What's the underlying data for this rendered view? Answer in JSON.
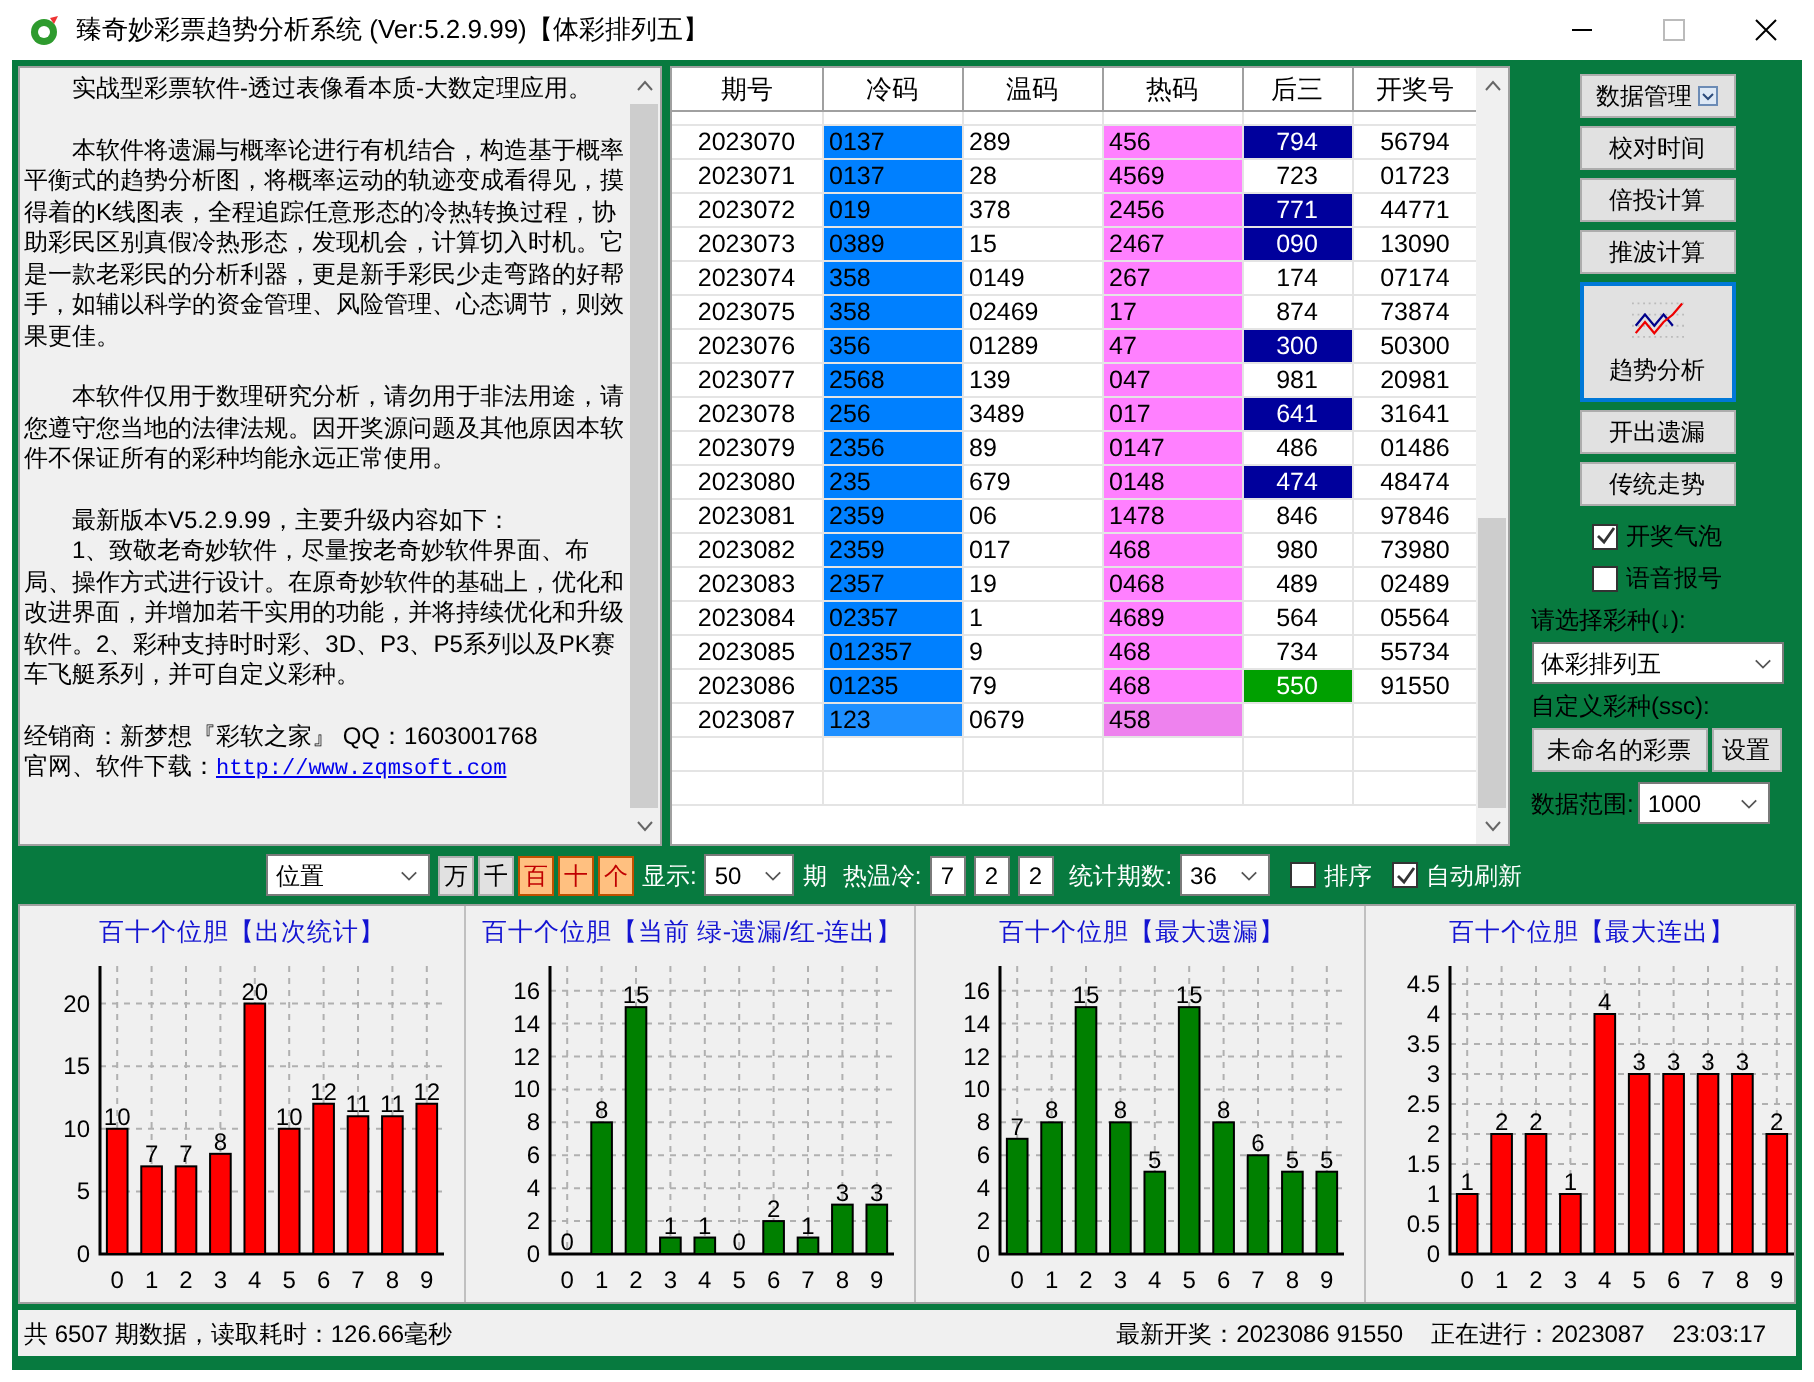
{
  "window": {
    "title": "臻奇妙彩票趋势分析系统 (Ver:5.2.9.99)【体彩排列五】"
  },
  "intro": [
    {
      "kind": "para",
      "text": "实战型彩票软件-透过表像看本质-大数定理应用。"
    },
    {
      "kind": "para",
      "text": "本软件将遗漏与概率论进行有机结合，构造基于概率平衡式的趋势分析图，将概率运动的轨迹变成看得见，摸得着的K线图表，全程追踪任意形态的冷热转换过程，协助彩民区别真假冷热形态，发现机会，计算切入时机。它是一款老彩民的分析利器，更是新手彩民少走弯路的好帮手，如辅以科学的资金管理、风险管理、心态调节，则效果更佳。"
    },
    {
      "kind": "para",
      "text": "本软件仅用于数理研究分析，请勿用于非法用途，请您遵守您当地的法律法规。因开奖源问题及其他原因本软件不保证所有的彩种均能永远正常使用。"
    },
    {
      "kind": "para",
      "text": "最新版本V5.2.9.99，主要升级内容如下："
    },
    {
      "kind": "item",
      "text": "1、致敬老奇妙软件，尽量按老奇妙软件界面、布局、操作方式进行设计。在原奇妙软件的基础上，优化和改进界面，并增加若干实用的功能，并将持续优化和升级软件。2、彩种支持时时彩、3D、P3、P5系列以及PK赛车飞艇系列，并可自定义彩种。"
    },
    {
      "kind": "line",
      "text": "经销商：新梦想『彩软之家』 QQ：1603001768"
    },
    {
      "kind": "link",
      "text": "官网、软件下载：",
      "link": "http://www.zqmsoft.com"
    }
  ],
  "table": {
    "columns": [
      "期号",
      "冷码",
      "温码",
      "热码",
      "后三",
      "开奖号"
    ],
    "rows": [
      {
        "period": "2023070",
        "cold": "0137",
        "warm": "289",
        "hot": "456",
        "last3": "794",
        "number": "56794",
        "color": "#00009c",
        "pending": false
      },
      {
        "period": "2023071",
        "cold": "0137",
        "warm": "28",
        "hot": "4569",
        "last3": "723",
        "number": "01723",
        "pending": false
      },
      {
        "period": "2023072",
        "cold": "019",
        "warm": "378",
        "hot": "2456",
        "last3": "771",
        "number": "44771",
        "color": "#00009c",
        "pending": false
      },
      {
        "period": "2023073",
        "cold": "0389",
        "warm": "15",
        "hot": "2467",
        "last3": "090",
        "number": "13090",
        "color": "#00009c",
        "pending": false
      },
      {
        "period": "2023074",
        "cold": "358",
        "warm": "0149",
        "hot": "267",
        "last3": "174",
        "number": "07174",
        "pending": false
      },
      {
        "period": "2023075",
        "cold": "358",
        "warm": "02469",
        "hot": "17",
        "last3": "874",
        "number": "73874",
        "pending": false
      },
      {
        "period": "2023076",
        "cold": "356",
        "warm": "01289",
        "hot": "47",
        "last3": "300",
        "number": "50300",
        "color": "#00009c",
        "pending": false
      },
      {
        "period": "2023077",
        "cold": "2568",
        "warm": "139",
        "hot": "047",
        "last3": "981",
        "number": "20981",
        "pending": false
      },
      {
        "period": "2023078",
        "cold": "256",
        "warm": "3489",
        "hot": "017",
        "last3": "641",
        "number": "31641",
        "color": "#00009c",
        "pending": false
      },
      {
        "period": "2023079",
        "cold": "2356",
        "warm": "89",
        "hot": "0147",
        "last3": "486",
        "number": "01486",
        "pending": false
      },
      {
        "period": "2023080",
        "cold": "235",
        "warm": "679",
        "hot": "0148",
        "last3": "474",
        "number": "48474",
        "color": "#00009c",
        "pending": false
      },
      {
        "period": "2023081",
        "cold": "2359",
        "warm": "06",
        "hot": "1478",
        "last3": "846",
        "number": "97846",
        "pending": false
      },
      {
        "period": "2023082",
        "cold": "2359",
        "warm": "017",
        "hot": "468",
        "last3": "980",
        "number": "73980",
        "pending": false
      },
      {
        "period": "2023083",
        "cold": "2357",
        "warm": "19",
        "hot": "0468",
        "last3": "489",
        "number": "02489",
        "pending": false
      },
      {
        "period": "2023084",
        "cold": "02357",
        "warm": "1",
        "hot": "4689",
        "last3": "564",
        "number": "05564",
        "pending": false
      },
      {
        "period": "2023085",
        "cold": "012357",
        "warm": "9",
        "hot": "468",
        "last3": "734",
        "number": "55734",
        "pending": false
      },
      {
        "period": "2023086",
        "cold": "01235",
        "warm": "79",
        "hot": "468",
        "last3": "550",
        "number": "91550",
        "color": "#00a000",
        "pending": false
      },
      {
        "period": "2023087",
        "cold": "123",
        "warm": "0679",
        "hot": "458",
        "pending": true
      }
    ]
  },
  "side": {
    "buttons": [
      {
        "kind": "menu",
        "label": "数据管理"
      },
      {
        "kind": "plain",
        "label": "校对时间"
      },
      {
        "kind": "plain",
        "label": "倍投计算"
      },
      {
        "kind": "plain",
        "label": "推波计算"
      },
      {
        "kind": "big",
        "label": "趋势分析",
        "selected": true
      },
      {
        "kind": "plain",
        "label": "开出遗漏"
      },
      {
        "kind": "plain",
        "label": "传统走势"
      }
    ],
    "checks": [
      {
        "label": "开奖气泡",
        "checked": true
      },
      {
        "label": "语音报号",
        "checked": false
      }
    ],
    "lottery_label": "请选择彩种(↓):",
    "lottery": "体彩排列五",
    "custom_label": "自定义彩种(ssc):",
    "custom_button": "未命名的彩票",
    "settings_button": "设置",
    "range_label": "数据范围:",
    "range": "1000"
  },
  "toolbar": {
    "position": "位置",
    "digits": [
      {
        "label": "万",
        "selected": false
      },
      {
        "label": "千",
        "selected": false
      },
      {
        "label": "百",
        "selected": true
      },
      {
        "label": "十",
        "selected": true
      },
      {
        "label": "个",
        "selected": true
      }
    ],
    "show_label": "显示:",
    "show": "50",
    "period_label": "期",
    "htc_label": "热温冷:",
    "htc": [
      "7",
      "2",
      "2"
    ],
    "stat_label": "统计期数:",
    "stat": "36",
    "options": [
      {
        "label": "排序",
        "checked": false
      },
      {
        "label": "自动刷新",
        "checked": true
      }
    ]
  },
  "charts": [
    {
      "chart_data": {
        "type": "bar",
        "title": "百十个位胆【出次统计】",
        "categories": [
          "0",
          "1",
          "2",
          "3",
          "4",
          "5",
          "6",
          "7",
          "8",
          "9"
        ],
        "ylim": [
          0,
          23
        ],
        "yticks": [
          0,
          5,
          10,
          15,
          20
        ],
        "data_labels": true,
        "grid": true,
        "series": [
          {
            "color": "#ff0000",
            "values": [
              10,
              7,
              7,
              8,
              20,
              10,
              12,
              11,
              11,
              12
            ]
          }
        ]
      }
    },
    {
      "chart_data": {
        "type": "bar",
        "title": "百十个位胆【当前 绿-遗漏/红-连出】",
        "categories": [
          "0",
          "1",
          "2",
          "3",
          "4",
          "5",
          "6",
          "7",
          "8",
          "9"
        ],
        "ylim": [
          0,
          17.5
        ],
        "yticks": [
          0,
          2,
          4,
          6,
          8,
          10,
          12,
          14,
          16
        ],
        "data_labels": true,
        "grid": true,
        "series": [
          {
            "color": "#008000",
            "values": [
              0,
              8,
              15,
              1,
              1,
              0,
              2,
              1,
              3,
              3
            ]
          }
        ]
      }
    },
    {
      "chart_data": {
        "type": "bar",
        "title": "百十个位胆【最大遗漏】",
        "categories": [
          "0",
          "1",
          "2",
          "3",
          "4",
          "5",
          "6",
          "7",
          "8",
          "9"
        ],
        "ylim": [
          0,
          17.5
        ],
        "yticks": [
          0,
          2,
          4,
          6,
          8,
          10,
          12,
          14,
          16
        ],
        "data_labels": true,
        "grid": true,
        "series": [
          {
            "color": "#008000",
            "values": [
              7,
              8,
              15,
              8,
              5,
              15,
              8,
              6,
              5,
              5
            ]
          }
        ]
      }
    },
    {
      "chart_data": {
        "type": "bar",
        "title": "百十个位胆【最大连出】",
        "categories": [
          "0",
          "1",
          "2",
          "3",
          "4",
          "5",
          "6",
          "7",
          "8",
          "9"
        ],
        "ylim": [
          0,
          4.8
        ],
        "yticks": [
          0,
          0.5,
          1,
          1.5,
          2,
          2.5,
          3,
          3.5,
          4,
          4.5
        ],
        "data_labels": true,
        "grid": true,
        "series": [
          {
            "color": "#ff0000",
            "values": [
              1,
              2,
              2,
              1,
              4,
              3,
              3,
              3,
              3,
              2
            ]
          }
        ]
      }
    }
  ],
  "status_bar": {
    "left": "共 6507 期数据，读取耗时：126.66毫秒",
    "latest": "最新开奖：2023086 91550",
    "current": "正在进行：2023087",
    "time": "23:03:17"
  }
}
